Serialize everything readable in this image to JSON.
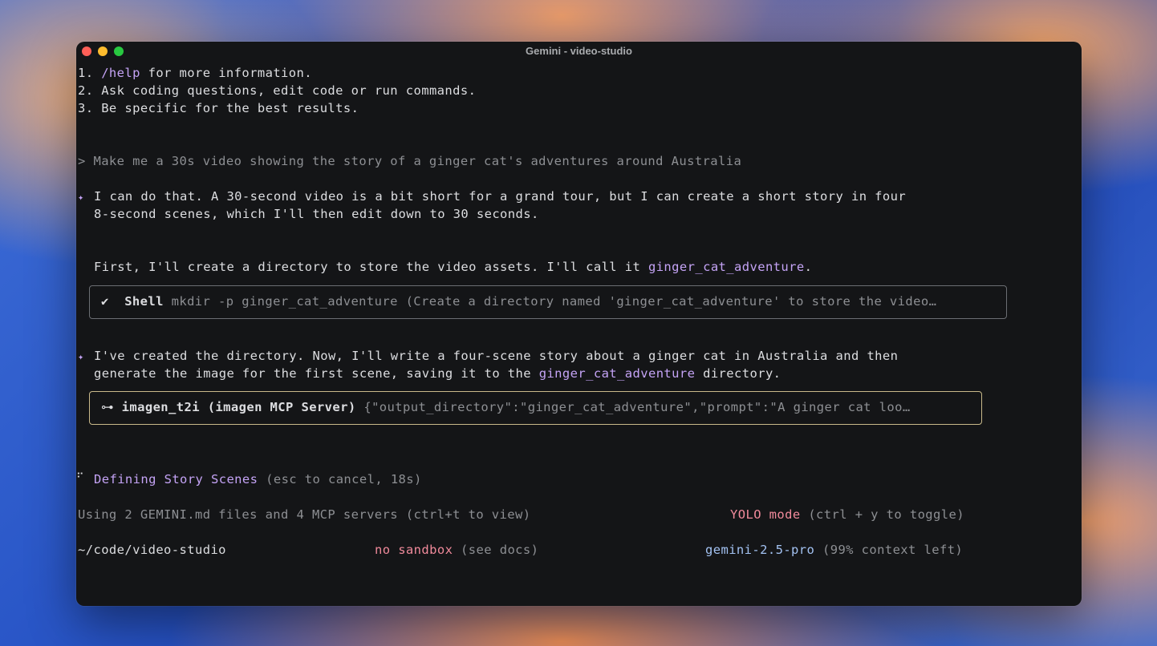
{
  "window": {
    "title": "Gemini - video-studio"
  },
  "tips": [
    {
      "num": "1.",
      "cmd": "/help",
      "text": " for more information."
    },
    {
      "num": "2.",
      "text": "Ask coding questions, edit code or run commands."
    },
    {
      "num": "3.",
      "text": "Be specific for the best results."
    }
  ],
  "prompt": {
    "marker": ">",
    "text": "Make me a 30s video showing the story of a ginger cat's adventures around Australia"
  },
  "response1": {
    "marker": "✦",
    "line1": "I can do that. A 30-second video is a bit short for a grand tour, but I can create a short story in four",
    "line2": "8-second scenes, which I'll then edit down to 30 seconds.",
    "line3_a": "First, I'll create a directory to store the video assets. I'll call it ",
    "line3_dir": "ginger_cat_adventure",
    "line3_b": "."
  },
  "tool_shell": {
    "status_icon": "✔",
    "name": "Shell",
    "args": "mkdir -p ginger_cat_adventure (Create a directory named 'ginger_cat_adventure' to store the video…"
  },
  "response2": {
    "marker": "✦",
    "line1": "I've created the directory. Now, I'll write a four-scene story about a ginger cat in Australia and then",
    "line2_a": "generate the image for the first scene, saving it to the ",
    "line2_dir": "ginger_cat_adventure",
    "line2_b": " directory."
  },
  "tool_imagen": {
    "status_icon": "⊶",
    "name": "imagen_t2i (imagen MCP Server)",
    "args": "{\"output_directory\":\"ginger_cat_adventure\",\"prompt\":\"A ginger cat loo…"
  },
  "spinner": {
    "icon": "⠋",
    "label": "Defining Story Scenes",
    "hint": " (esc to cancel, 18s)"
  },
  "status": {
    "context_files": "Using 2 GEMINI.md files and 4 MCP servers (ctrl+t to view)",
    "yolo": "YOLO mode",
    "yolo_hint": " (ctrl + y to toggle)",
    "cwd": "~/code/video-studio",
    "sandbox": "no sandbox",
    "sandbox_hint": " (see docs)",
    "model": "gemini-2.5-pro",
    "model_hint": " (99% context left)"
  },
  "colors": {
    "accent_purple": "#c4a3f5",
    "yolo_pink": "#f08a9b",
    "model_blue": "#a3c2f2",
    "terminal_bg": "#141517"
  }
}
